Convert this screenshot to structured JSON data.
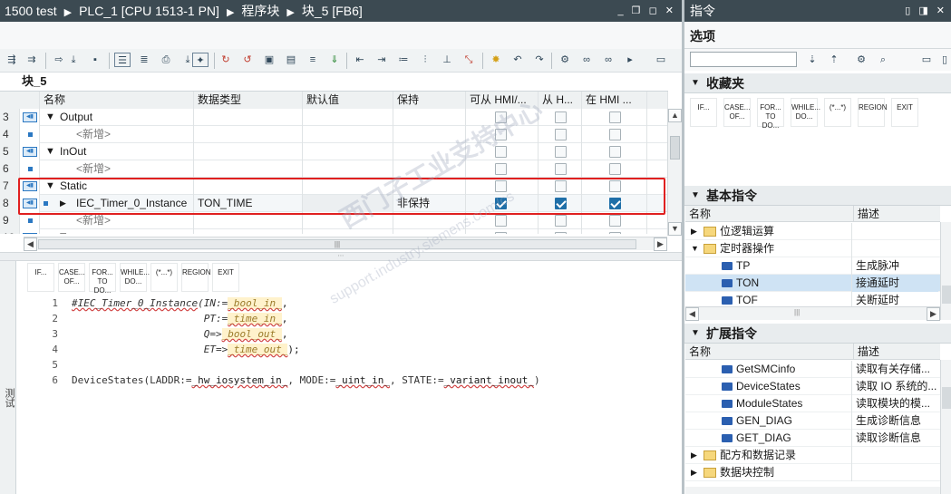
{
  "editor": {
    "breadcrumb": [
      "1500 test",
      "PLC_1 [CPU 1513-1 PN]",
      "程序块",
      "块_5 [FB6]"
    ],
    "window_controls": "_ ❐ ◻ ✕",
    "block_name": "块_5",
    "columns": [
      "名称",
      "数据类型",
      "默认值",
      "保持",
      "可从 HMI/...",
      "从 H...",
      "在 HMI ..."
    ],
    "rows": [
      {
        "num": "3",
        "expander": "▼",
        "name": "Output",
        "type": "",
        "retain": "",
        "checks": [
          false,
          false,
          false
        ],
        "kind": "section"
      },
      {
        "num": "4",
        "expander": "",
        "name": "<新增>",
        "type": "",
        "retain": "",
        "checks": [
          false,
          false,
          false
        ],
        "kind": "add"
      },
      {
        "num": "5",
        "expander": "▼",
        "name": "InOut",
        "type": "",
        "retain": "",
        "checks": [
          false,
          false,
          false
        ],
        "kind": "section"
      },
      {
        "num": "6",
        "expander": "",
        "name": "<新增>",
        "type": "",
        "retain": "",
        "checks": [
          false,
          false,
          false
        ],
        "kind": "add"
      },
      {
        "num": "7",
        "expander": "▼",
        "name": "Static",
        "type": "",
        "retain": "",
        "checks": [
          false,
          false,
          false
        ],
        "kind": "section"
      },
      {
        "num": "8",
        "expander": "▶",
        "name": "IEC_Timer_0_Instance",
        "type": "TON_TIME",
        "retain": "非保持",
        "checks": [
          true,
          true,
          true
        ],
        "kind": "var"
      },
      {
        "num": "9",
        "expander": "",
        "name": "<新增>",
        "type": "",
        "retain": "",
        "checks": [
          false,
          false,
          false
        ],
        "kind": "add"
      },
      {
        "num": "10",
        "expander": "▼",
        "name": "T...",
        "type": "",
        "retain": "",
        "checks": [
          false,
          false,
          false
        ],
        "kind": "section"
      }
    ],
    "instruction_bar": [
      "IF...",
      "CASE... OF...",
      "FOR... TO DO...",
      "WHILE... DO...",
      "(*...*)",
      "REGION",
      "EXIT"
    ],
    "code_lines": [
      {
        "num": "1",
        "parts": [
          {
            "t": "#IEC_Timer_0_Instance",
            "c": "prm squig"
          },
          {
            "t": "(IN:=",
            "c": "prm"
          },
          {
            "t": "_bool_in_",
            "c": "ph"
          },
          {
            "t": ",",
            "c": ""
          }
        ]
      },
      {
        "num": "2",
        "parts": [
          {
            "t": "                      PT:=",
            "c": "prm"
          },
          {
            "t": "_time_in_",
            "c": "ph"
          },
          {
            "t": ",",
            "c": ""
          }
        ]
      },
      {
        "num": "3",
        "parts": [
          {
            "t": "                      Q=>",
            "c": "prm"
          },
          {
            "t": "_bool_out_",
            "c": "ph"
          },
          {
            "t": ",",
            "c": ""
          }
        ]
      },
      {
        "num": "4",
        "parts": [
          {
            "t": "                      ET=>",
            "c": "prm"
          },
          {
            "t": "_time_out_",
            "c": "ph"
          },
          {
            "t": ");",
            "c": ""
          }
        ]
      },
      {
        "num": "5",
        "parts": []
      },
      {
        "num": "6",
        "parts": [
          {
            "t": "DeviceStates(LADDR:=",
            "c": "kw"
          },
          {
            "t": "_hw_iosystem_in_",
            "c": "squig"
          },
          {
            "t": ", MODE:=",
            "c": "kw"
          },
          {
            "t": "_uint_in_",
            "c": "squig"
          },
          {
            "t": ", STATE:=",
            "c": "kw"
          },
          {
            "t": "_variant_inout_",
            "c": "squig"
          },
          {
            "t": ")",
            "c": "kw"
          }
        ]
      }
    ],
    "side_tab": "测试",
    "colors": {
      "accent": "#2b78c2",
      "highlight_box": "#e02020",
      "title_bg": "#3c4a52"
    }
  },
  "instructions": {
    "title": "指令",
    "options_title": "选项",
    "search_placeholder": "",
    "favorites": {
      "title": "收藏夹",
      "items": [
        "IF...",
        "CASE... OF...",
        "FOR... TO DO...",
        "WHILE... DO...",
        "(*...*)",
        "REGION",
        "EXIT"
      ]
    },
    "basic": {
      "title": "基本指令",
      "columns": [
        "名称",
        "描述"
      ],
      "rows": [
        {
          "name": "位逻辑运算",
          "desc": "",
          "indent": 0,
          "kind": "folder",
          "expander": "▶"
        },
        {
          "name": "定时器操作",
          "desc": "",
          "indent": 0,
          "kind": "folder",
          "expander": "▼"
        },
        {
          "name": "TP",
          "desc": "生成脉冲",
          "indent": 1,
          "kind": "block",
          "expander": ""
        },
        {
          "name": "TON",
          "desc": "接通延时",
          "indent": 1,
          "kind": "block",
          "expander": "",
          "selected": true
        },
        {
          "name": "TOF",
          "desc": "关断延时",
          "indent": 1,
          "kind": "block",
          "expander": ""
        }
      ]
    },
    "extended": {
      "title": "扩展指令",
      "columns": [
        "名称",
        "描述"
      ],
      "rows": [
        {
          "name": "GetSMCinfo",
          "desc": "读取有关存储...",
          "indent": 1,
          "kind": "block",
          "expander": ""
        },
        {
          "name": "DeviceStates",
          "desc": "读取 IO 系统的...",
          "indent": 1,
          "kind": "block",
          "expander": ""
        },
        {
          "name": "ModuleStates",
          "desc": "读取模块的模...",
          "indent": 1,
          "kind": "block",
          "expander": ""
        },
        {
          "name": "GEN_DIAG",
          "desc": "生成诊断信息",
          "indent": 1,
          "kind": "block",
          "expander": ""
        },
        {
          "name": "GET_DIAG",
          "desc": "读取诊断信息",
          "indent": 1,
          "kind": "block",
          "expander": ""
        },
        {
          "name": "配方和数据记录",
          "desc": "",
          "indent": 0,
          "kind": "folder",
          "expander": "▶"
        },
        {
          "name": "数据块控制",
          "desc": "",
          "indent": 0,
          "kind": "folder",
          "expander": "▶"
        }
      ]
    }
  }
}
